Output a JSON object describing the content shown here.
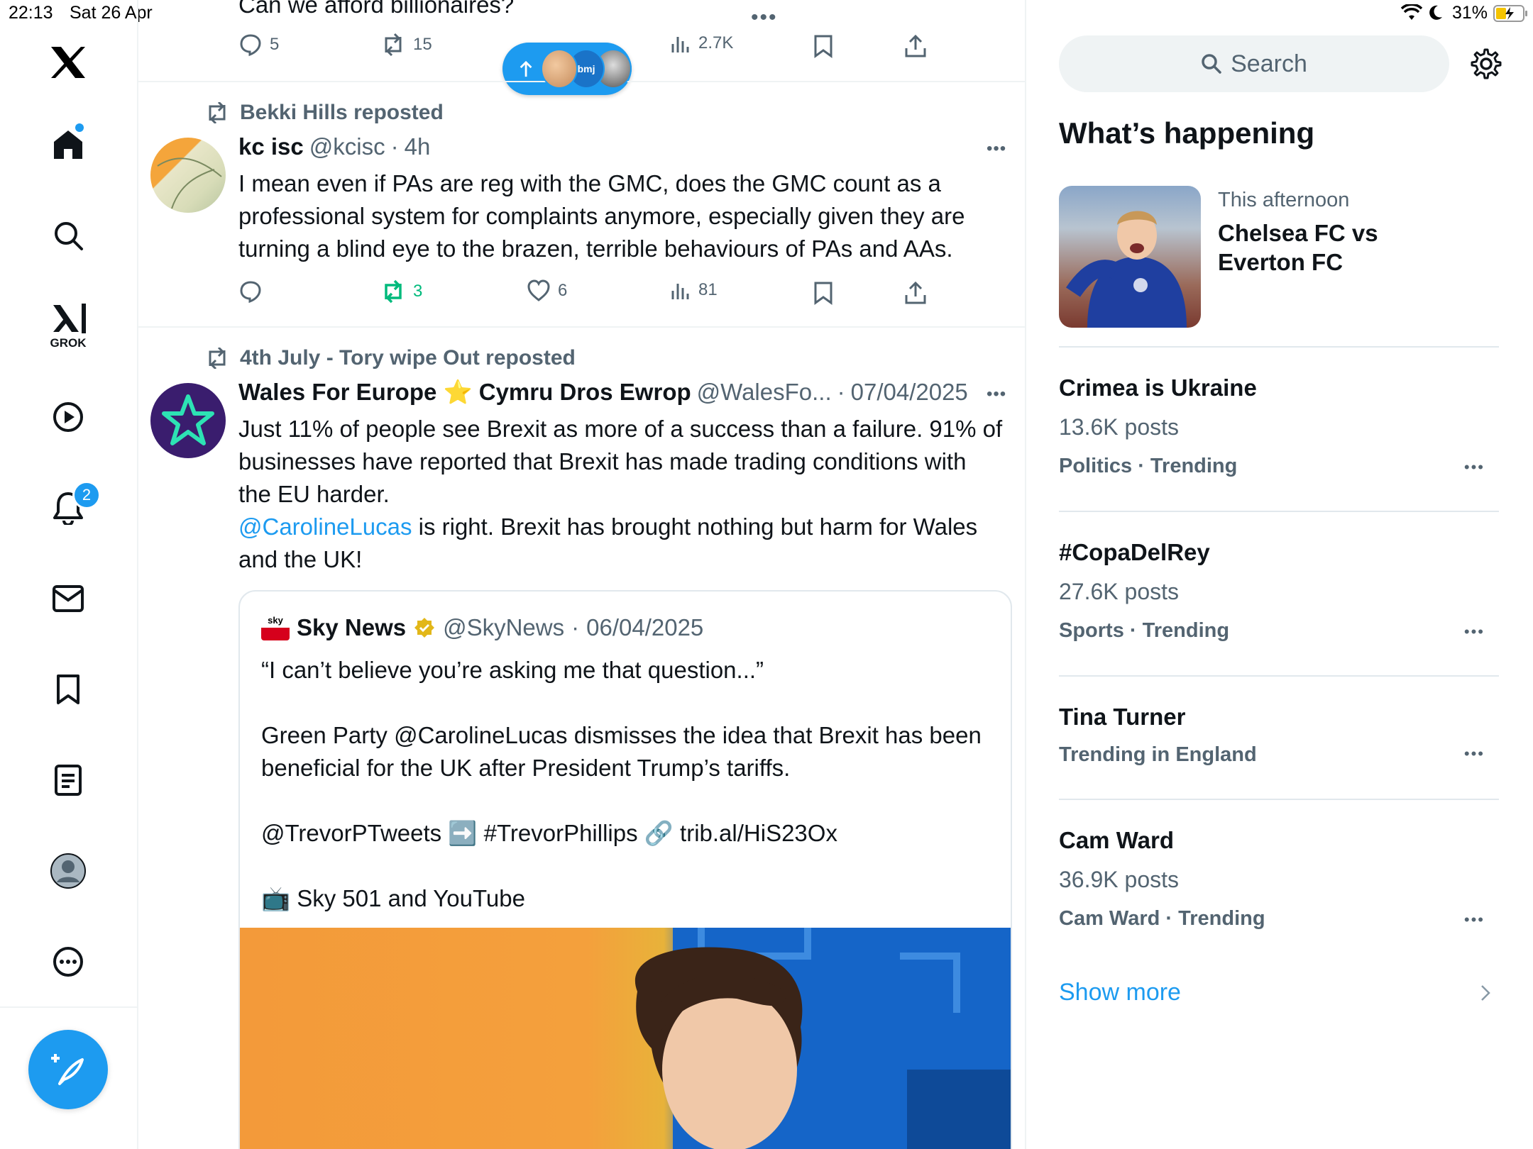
{
  "status_bar": {
    "time": "22:13",
    "date": "Sat 26 Apr",
    "battery": "31%"
  },
  "nav": {
    "items": [
      "home-icon",
      "search-icon",
      "grok-icon",
      "video-icon",
      "notifications-icon",
      "messages-icon",
      "bookmarks-icon",
      "lists-icon",
      "profile-icon",
      "more-icon"
    ],
    "grok_label": "GROK",
    "notifications_badge": "2"
  },
  "feed": {
    "top_tweet": {
      "text": "Can we afford billionaires?",
      "replies": "5",
      "reposts": "15",
      "views": "2.7K"
    },
    "tweet1": {
      "reposter": "Bekki Hills reposted",
      "name": "kc isc",
      "handle": "@kcisc",
      "time": "4h",
      "text": "I mean even if PAs are reg with the GMC, does the GMC count as a professional system for complaints anymore, especially given they are turning a blind eye to the brazen, terrible behaviours of PAs and AAs.",
      "replies": "",
      "reposts": "3",
      "likes": "6",
      "views": "81"
    },
    "tweet2": {
      "reposter": "4th July - Tory wipe Out reposted",
      "name": "Wales For Europe ⭐ Cymru Dros Ewrop",
      "handle": "@WalesFo...",
      "date": "07/04/2025",
      "text1": "Just 11% of people see Brexit as more of a success than a failure. 91% of businesses have reported that Brexit has made trading conditions with the EU harder.",
      "mention": "@CarolineLucas",
      "text2": " is right. Brexit has brought nothing but harm for Wales and the UK!"
    },
    "quote": {
      "name": "Sky News",
      "handle": "@SkyNews",
      "date": "06/04/2025",
      "line1": "“I can’t believe you’re asking me that question...”",
      "line2": "Green Party @CarolineLucas dismisses the idea that Brexit has been beneficial for the UK after President Trump’s tariffs.",
      "line3": "@TrevorPTweets ➡️ #TrevorPhillips 🔗 trib.al/HiS23Ox",
      "line4": "📺 Sky 501 and YouTube"
    },
    "new_posts_pill": "bmj"
  },
  "sidebar": {
    "search_placeholder": "Search",
    "heading": "What’s happening",
    "event": {
      "time": "This afternoon",
      "title": "Chelsea FC vs Everton FC"
    },
    "trends": [
      {
        "title": "Crimea is Ukraine",
        "posts": "13.6K posts",
        "meta": "Politics · Trending"
      },
      {
        "title": "#CopaDelRey",
        "posts": "27.6K posts",
        "meta": "Sports · Trending"
      },
      {
        "title": "Tina Turner",
        "posts": "",
        "meta": "Trending in England"
      },
      {
        "title": "Cam Ward",
        "posts": "36.9K posts",
        "meta": "Cam Ward · Trending"
      }
    ],
    "show_more": "Show more"
  },
  "colors": {
    "accent": "#1d9bf0",
    "repost_green": "#00ba7c",
    "muted": "#536471"
  }
}
